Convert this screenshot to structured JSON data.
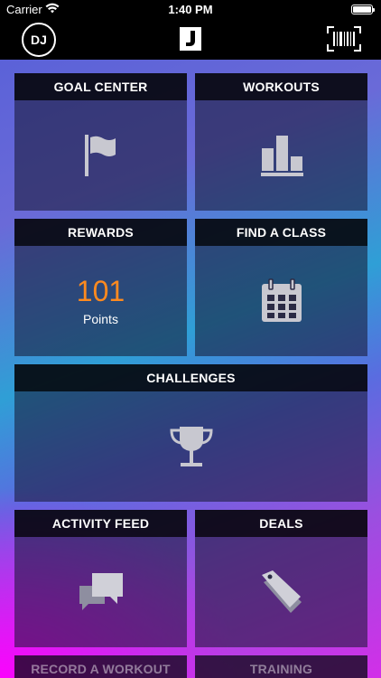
{
  "status_bar": {
    "carrier": "Carrier",
    "time": "1:40 PM"
  },
  "nav": {
    "avatar_initials": "DJ",
    "logo_letter": "J"
  },
  "tiles": {
    "goal_center": "GOAL CENTER",
    "workouts": "WORKOUTS",
    "rewards": "REWARDS",
    "rewards_points_value": "101",
    "rewards_points_label": "Points",
    "find_a_class": "FIND A CLASS",
    "challenges": "CHALLENGES",
    "activity_feed": "ACTIVITY FEED",
    "deals": "DEALS",
    "record_a_workout": "RECORD A WORKOUT",
    "training": "TRAINING"
  },
  "icons": {
    "goal_center": "flag-icon",
    "workouts": "bar-chart-icon",
    "find_a_class": "calendar-icon",
    "challenges": "trophy-icon",
    "activity_feed": "chat-bubbles-icon",
    "deals": "tags-icon",
    "nav_left": "avatar",
    "nav_right": "barcode-scanner-icon"
  },
  "colors": {
    "points": "#ff8a1f",
    "tile_header": "#000000"
  }
}
